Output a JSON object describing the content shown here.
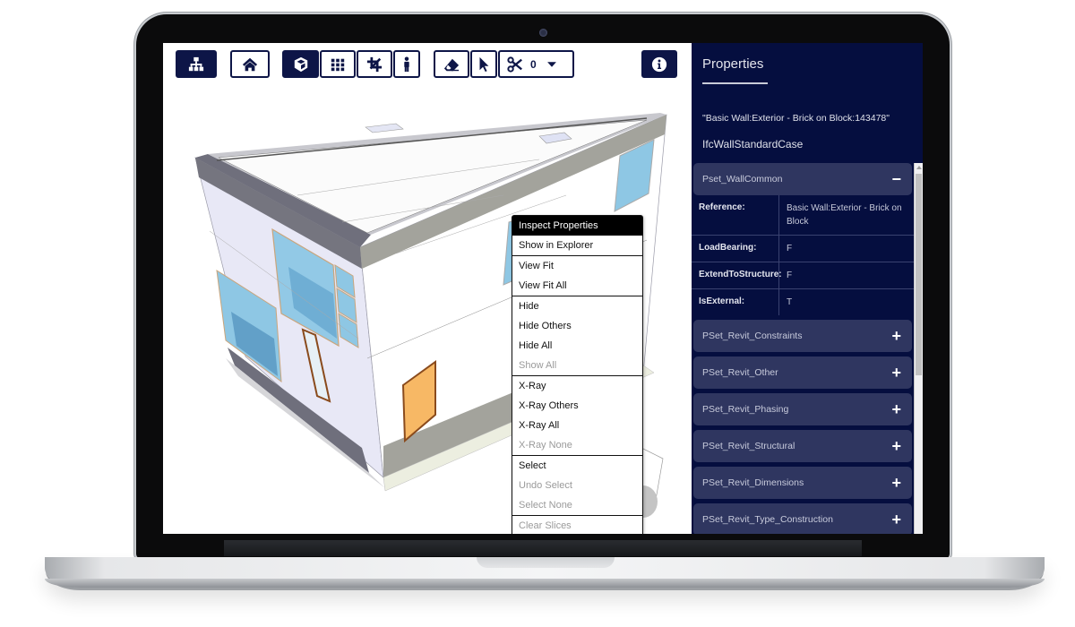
{
  "toolbar": {
    "buttons": [
      {
        "id": "explorer",
        "icon": "sitemap-icon",
        "active": true
      },
      {
        "id": "home",
        "icon": "home-icon",
        "active": false
      },
      {
        "id": "perspective",
        "icon": "cube-icon",
        "active": true
      },
      {
        "id": "grid",
        "icon": "grid-icon",
        "active": false
      },
      {
        "id": "crop",
        "icon": "crop-icon",
        "active": false
      },
      {
        "id": "first-person",
        "icon": "person-icon",
        "active": false
      },
      {
        "id": "eraser",
        "icon": "eraser-icon",
        "active": false
      },
      {
        "id": "select",
        "icon": "pointer-icon",
        "active": false
      },
      {
        "id": "slice",
        "icon": "scissors-icon",
        "active": false
      }
    ],
    "slice_count": "0",
    "info_icon": "info-icon"
  },
  "context_menu": {
    "groups": [
      [
        {
          "label": "Inspect Properties",
          "state": "active"
        },
        {
          "label": "Show in Explorer",
          "state": "enabled"
        }
      ],
      [
        {
          "label": "View Fit",
          "state": "enabled"
        },
        {
          "label": "View Fit All",
          "state": "enabled"
        }
      ],
      [
        {
          "label": "Hide",
          "state": "enabled"
        },
        {
          "label": "Hide Others",
          "state": "enabled"
        },
        {
          "label": "Hide All",
          "state": "enabled"
        },
        {
          "label": "Show All",
          "state": "disabled"
        }
      ],
      [
        {
          "label": "X-Ray",
          "state": "enabled"
        },
        {
          "label": "X-Ray Others",
          "state": "enabled"
        },
        {
          "label": "X-Ray All",
          "state": "enabled"
        },
        {
          "label": "X-Ray None",
          "state": "disabled"
        }
      ],
      [
        {
          "label": "Select",
          "state": "enabled"
        },
        {
          "label": "Undo Select",
          "state": "disabled"
        },
        {
          "label": "Select None",
          "state": "disabled"
        }
      ],
      [
        {
          "label": "Clear Slices",
          "state": "disabled"
        }
      ]
    ]
  },
  "properties": {
    "title": "Properties",
    "object_name": "\"Basic Wall:Exterior - Brick on Block:143478\"",
    "object_type": "IfcWallStandardCase",
    "psets": [
      {
        "name": "Pset_WallCommon",
        "expanded": true,
        "sign": "−",
        "rows": [
          {
            "key": "Reference:",
            "value": "Basic Wall:Exterior - Brick on Block"
          },
          {
            "key": "LoadBearing:",
            "value": "F"
          },
          {
            "key": "ExtendToStructure:",
            "value": "F"
          },
          {
            "key": "IsExternal:",
            "value": "T"
          }
        ]
      },
      {
        "name": "PSet_Revit_Constraints",
        "expanded": false,
        "sign": "+"
      },
      {
        "name": "PSet_Revit_Other",
        "expanded": false,
        "sign": "+"
      },
      {
        "name": "PSet_Revit_Phasing",
        "expanded": false,
        "sign": "+"
      },
      {
        "name": "PSet_Revit_Structural",
        "expanded": false,
        "sign": "+"
      },
      {
        "name": "PSet_Revit_Dimensions",
        "expanded": false,
        "sign": "+"
      },
      {
        "name": "PSet_Revit_Type_Construction",
        "expanded": false,
        "sign": "+"
      }
    ]
  },
  "colors": {
    "brand_dark": "#0d1547",
    "panel_bg": "#050e3f",
    "pset_header_bg": "#2f3660",
    "glass": "#8fc8e6",
    "door": "#f7b865"
  }
}
